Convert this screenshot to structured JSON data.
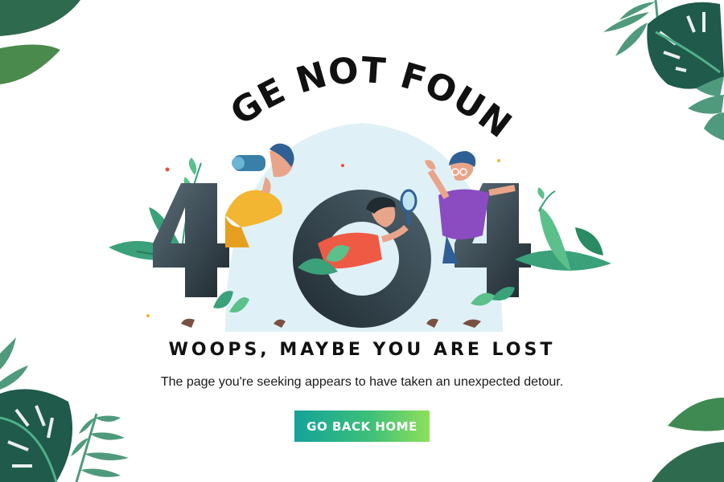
{
  "page": {
    "heading": "PAGE NOT FOUND",
    "error_code": "404",
    "subheading": "WOOPS, MAYBE YOU ARE LOST",
    "description": "The page you're seeking appears to have taken an unexpected detour.",
    "home_button_label": "GO BACK HOME"
  },
  "colors": {
    "background": "#ffffff",
    "text": "#111111",
    "leaf_dark": "#1f5a4a",
    "leaf_mid": "#3a8f6e",
    "leaf_light": "#5cc08a",
    "digit_dark": "#27323a",
    "digit_light": "#5b6e78",
    "sky_circle": "#dff1f7",
    "button_gradient_start": "#14a39a",
    "button_gradient_end": "#8de05a"
  },
  "icons": [
    "monstera-leaf-icon",
    "palm-leaf-icon",
    "binoculars-icon",
    "magnifying-glass-icon"
  ]
}
